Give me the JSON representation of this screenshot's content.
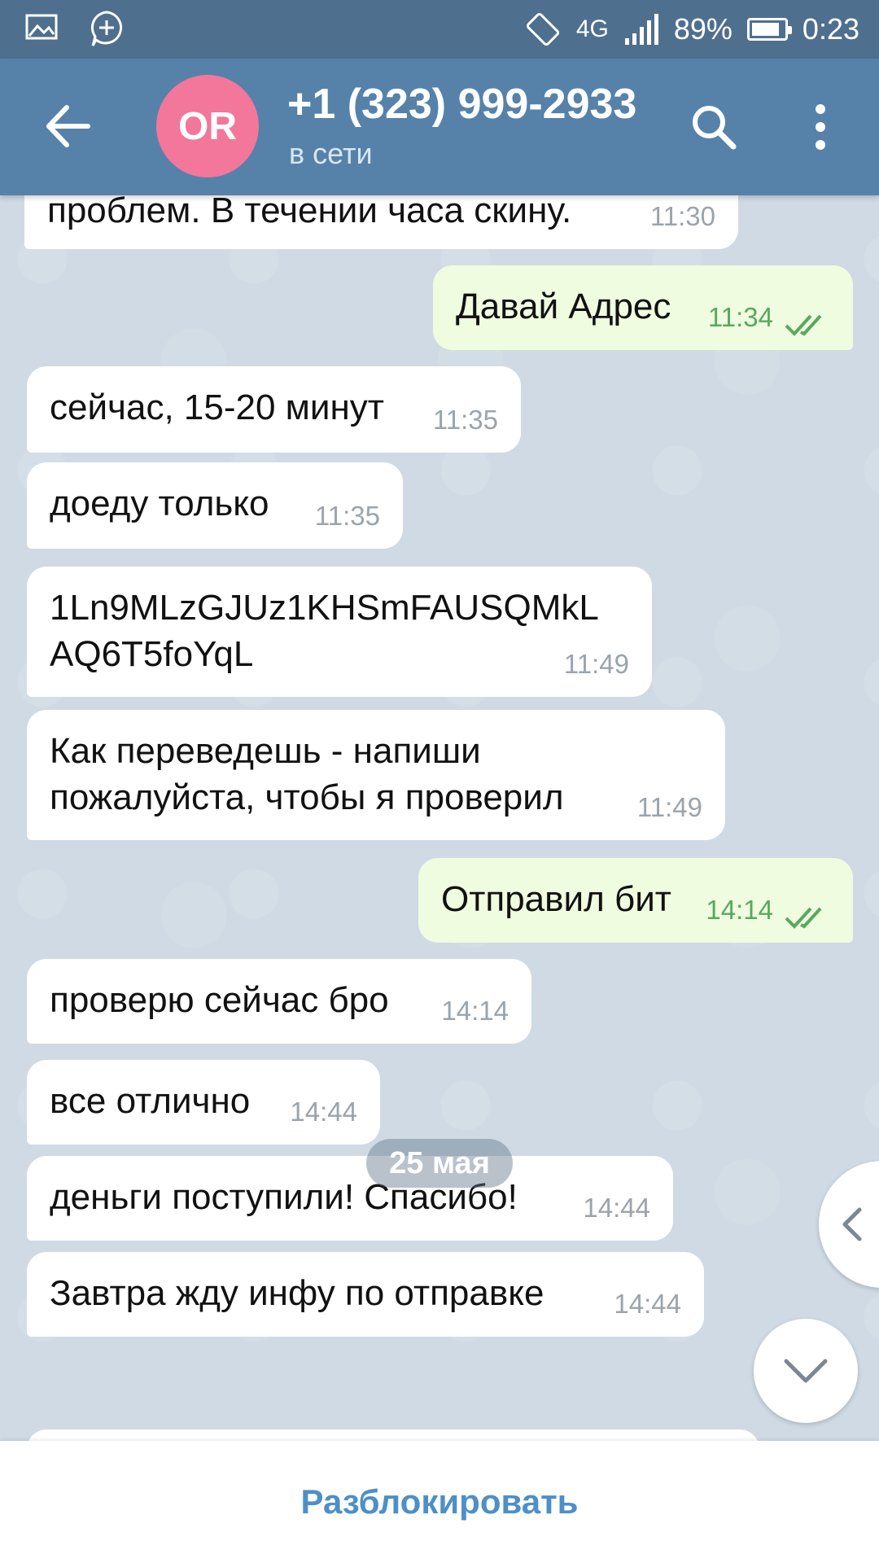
{
  "status_bar": {
    "network": "4G",
    "battery": "89%",
    "time": "0:23"
  },
  "header": {
    "avatar_initials": "OR",
    "title": "+1 (323) 999-2933",
    "status": "в сети"
  },
  "messages": [
    {
      "dir": "in",
      "text": "проблем. В течении часа скину.",
      "time": "11:30"
    },
    {
      "dir": "out",
      "text": "Давай Адрес",
      "time": "11:34",
      "read": true
    },
    {
      "dir": "in",
      "text": "сейчас, 15-20 минут",
      "time": "11:35"
    },
    {
      "dir": "in",
      "text": "доеду только",
      "time": "11:35"
    },
    {
      "dir": "in",
      "text": "1Ln9MLzGJUz1KHSmFAUSQMkL\nAQ6T5foYqL",
      "time": "11:49"
    },
    {
      "dir": "in",
      "text": "Как переведешь - напиши\nпожалуйста, чтобы я проверил",
      "time": "11:49"
    },
    {
      "dir": "out",
      "text": "Отправил бит",
      "time": "14:14",
      "read": true
    },
    {
      "dir": "in",
      "text": "проверю сейчас бро",
      "time": "14:14"
    },
    {
      "dir": "in",
      "text": "все отлично",
      "time": "14:44"
    },
    {
      "dir": "in",
      "text": "деньги поступили! Спасибо!",
      "time": "14:44"
    },
    {
      "dir": "in",
      "text": "Завтра жду инфу по отправке",
      "time": "14:44"
    }
  ],
  "date_separator": "25 мая",
  "bottom_bar": {
    "unblock_label": "Разблокировать"
  },
  "colors": {
    "status_bar": "#4f6f8f",
    "app_bar": "#5682a9",
    "avatar": "#f2779a",
    "incoming_bubble": "#ffffff",
    "outgoing_bubble": "#effcdf",
    "read_time": "#5aa860",
    "unblock": "#4e8fc5"
  },
  "icons": {
    "back": "arrow-left-icon",
    "search": "search-icon",
    "menu": "more-vertical-icon",
    "scroll_down": "chevron-down-icon",
    "side_panel": "chevron-left-icon"
  }
}
